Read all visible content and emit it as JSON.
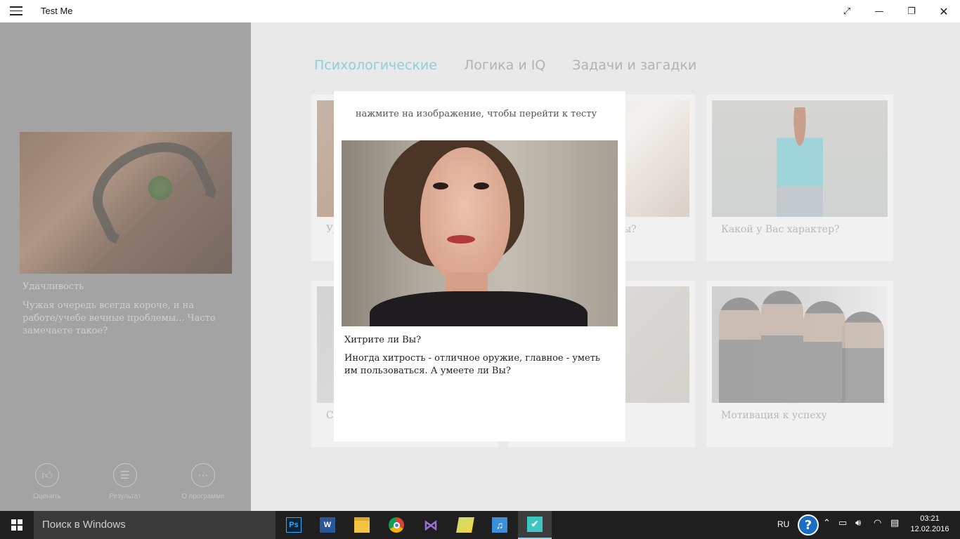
{
  "window": {
    "title": "Test Me",
    "menu_icon": "hamburger-icon",
    "controls": [
      "fullscreen-icon",
      "minimize-icon",
      "restore-icon",
      "close-icon"
    ]
  },
  "sidebar": {
    "featured": {
      "title": "Удачливость",
      "description": "Чужая очередь всегда короче, и на работе/учебе вечные проблемы... Часто замечаете такое?"
    },
    "actions": [
      {
        "label": "Оценить",
        "icon": "thumbs-up-icon"
      },
      {
        "label": "Результат",
        "icon": "list-icon"
      },
      {
        "label": "О программе",
        "icon": "more-icon"
      }
    ]
  },
  "tabs": [
    {
      "label": "Психологические",
      "active": true
    },
    {
      "label": "Логика и IQ",
      "active": false
    },
    {
      "label": "Задачи и загадки",
      "active": false
    }
  ],
  "cards": [
    {
      "caption": "Уд"
    },
    {
      "caption": "ы?"
    },
    {
      "caption": "Какой у Вас характер?"
    },
    {
      "caption": "С"
    },
    {
      "caption": ""
    },
    {
      "caption": "Мотивация к успеху"
    }
  ],
  "modal": {
    "hint": "нажмите на изображение, чтобы перейти к тесту",
    "title": "Хитрите ли Вы?",
    "description": "Иногда хитрость - отличное оружие, главное - уметь им пользоваться. А умеете ли Вы?"
  },
  "taskbar": {
    "search_placeholder": "Поиск в Windows",
    "apps": [
      {
        "name": "photoshop-icon",
        "label": "Ps"
      },
      {
        "name": "word-icon",
        "label": "W"
      },
      {
        "name": "file-explorer-icon",
        "label": ""
      },
      {
        "name": "chrome-icon",
        "label": ""
      },
      {
        "name": "visual-studio-icon",
        "label": ""
      },
      {
        "name": "folder-icon",
        "label": ""
      },
      {
        "name": "music-app-icon",
        "label": ""
      },
      {
        "name": "test-me-app-icon",
        "label": ""
      }
    ],
    "language": "RU",
    "time": "03:21",
    "date": "12.02.2016"
  }
}
